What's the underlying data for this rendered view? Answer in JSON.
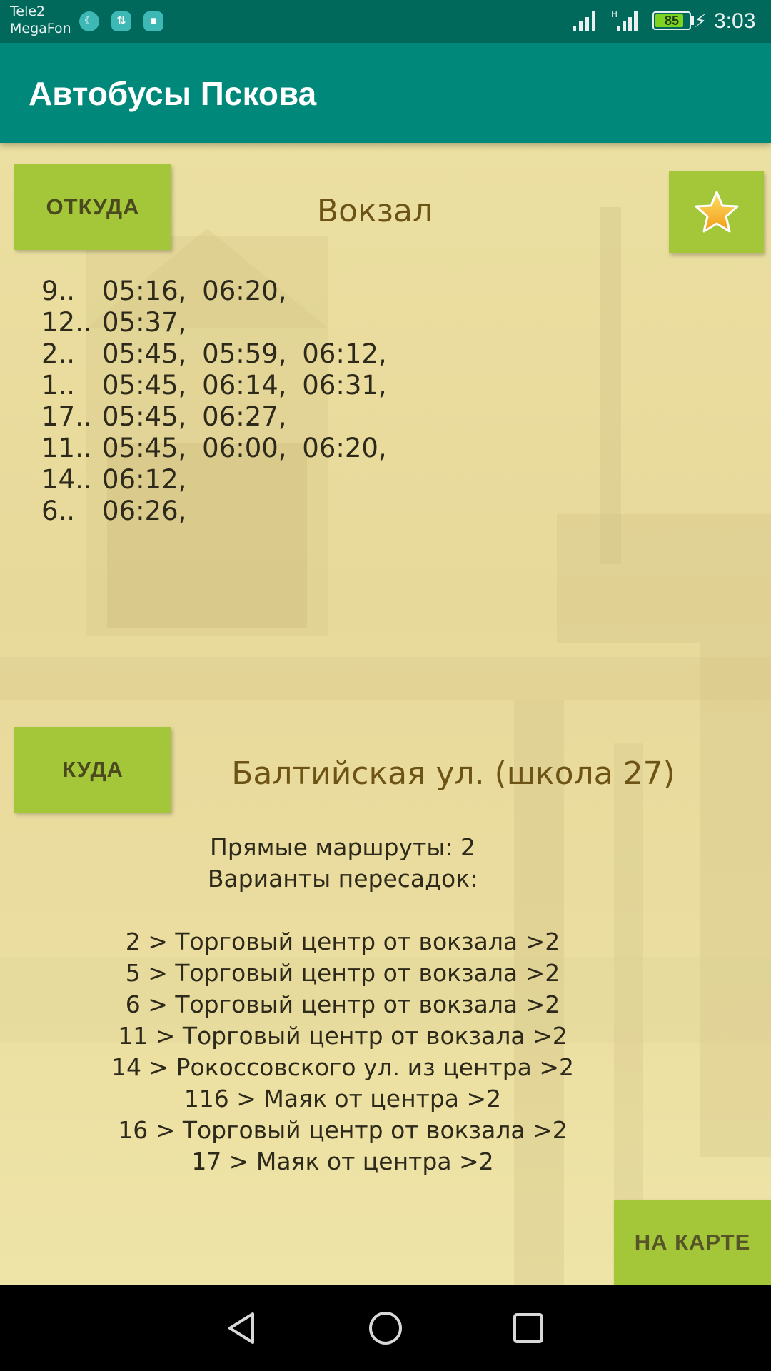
{
  "status_bar": {
    "carrier_1": "Tele2",
    "carrier_2": "MegaFon",
    "network_type": "H",
    "battery_level": "85",
    "battery_fraction": 0.85,
    "time": "3:03"
  },
  "app_bar": {
    "title": "Автобусы Пскова",
    "color": "#00897b"
  },
  "from_section": {
    "button_label": "ОТКУДА",
    "stop_name": "Вокзал",
    "favorite_icon": "star-icon"
  },
  "schedule": [
    {
      "route": "9..",
      "times": "05:16, 06:20,"
    },
    {
      "route": "12..",
      "times": "05:37,"
    },
    {
      "route": "2..",
      "times": "05:45, 05:59, 06:12,"
    },
    {
      "route": "1..",
      "times": "05:45, 06:14, 06:31,"
    },
    {
      "route": "17..",
      "times": "05:45, 06:27,"
    },
    {
      "route": "11..",
      "times": "05:45, 06:00, 06:20,"
    },
    {
      "route": "14..",
      "times": "06:12,"
    },
    {
      "route": "6..",
      "times": "06:26,"
    }
  ],
  "to_section": {
    "button_label": "КУДА",
    "stop_name": "Балтийская ул. (школа 27)"
  },
  "route_info": {
    "direct_routes": "Прямые маршруты: 2",
    "transfer_header": "Варианты пересадок:",
    "transfers": [
      "2 > Торговый центр от вокзала >2",
      "5 > Торговый центр от вокзала >2",
      "6 > Торговый центр от вокзала >2",
      "11 > Торговый центр от вокзала >2",
      "14 > Рокоссовского ул. из центра  >2",
      "116 > Маяк от центра >2",
      "16 > Торговый центр от вокзала >2",
      "17 > Маяк от центра >2"
    ]
  },
  "map_button": {
    "label": "НА КАРТЕ"
  },
  "colors": {
    "accent_green": "#a4c639",
    "status_bar": "#00695c",
    "stop_text": "#6d5415",
    "background": "#efe3a4"
  },
  "nav_bar": {
    "back_icon": "back-triangle-icon",
    "home_icon": "home-circle-icon",
    "recent_icon": "recent-apps-square-icon"
  }
}
